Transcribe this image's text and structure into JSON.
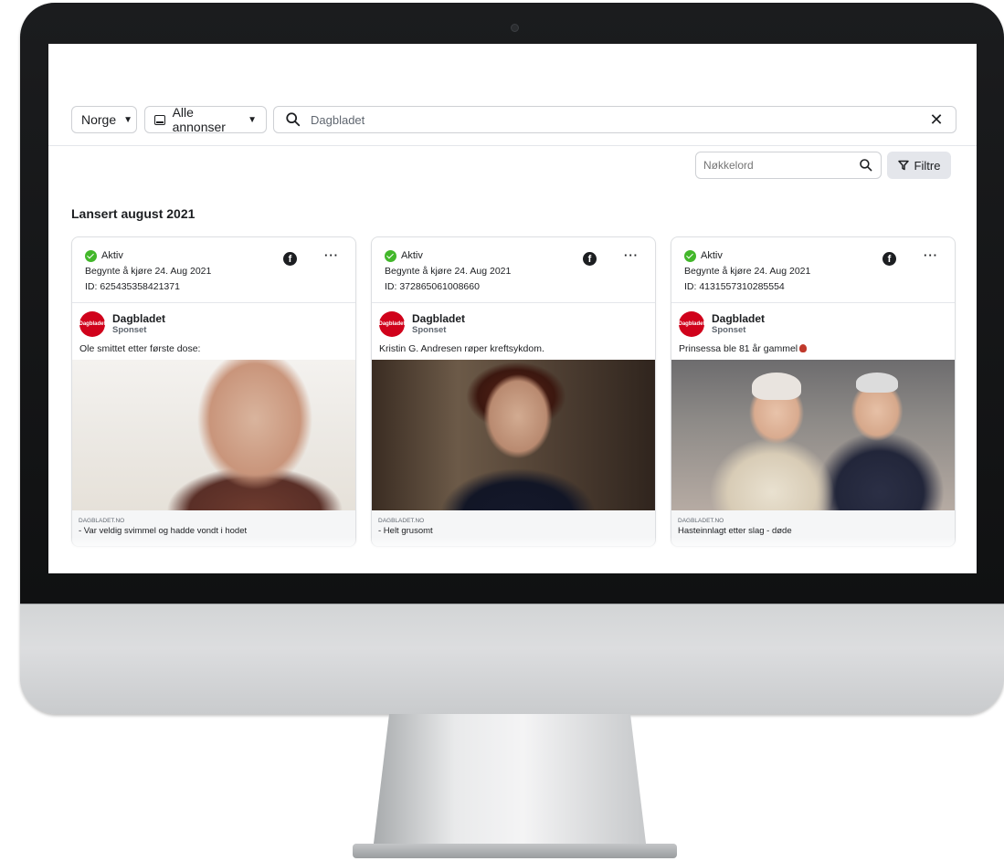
{
  "toolbar": {
    "country": "Norge",
    "ad_type": "Alle annonser",
    "search_value": "Dagbladet"
  },
  "filters": {
    "keyword_placeholder": "Nøkkelord",
    "filter_label": "Filtre"
  },
  "section": {
    "title": "Lansert august 2021"
  },
  "colors": {
    "active_green": "#42b72a",
    "brand_red": "#d0021b",
    "filter_bg": "#e4e6eb"
  },
  "cards": [
    {
      "status": "Aktiv",
      "started": "Begynte å kjøre 24. Aug 2021",
      "id": "ID: 625435358421371",
      "advertiser": "Dagbladet",
      "sponsored": "Sponset",
      "logo_text": "Dagbladet",
      "ad_text": "Ole smittet etter første dose:",
      "domain": "DAGBLADET.NO",
      "headline": "- Var veldig svimmel og hadde vondt i hodet"
    },
    {
      "status": "Aktiv",
      "started": "Begynte å kjøre 24. Aug 2021",
      "id": "ID: 372865061008660",
      "advertiser": "Dagbladet",
      "sponsored": "Sponset",
      "logo_text": "Dagbladet",
      "ad_text": "Kristin G. Andresen røper kreftsykdom.",
      "domain": "DAGBLADET.NO",
      "headline": "- Helt grusomt"
    },
    {
      "status": "Aktiv",
      "started": "Begynte å kjøre 24. Aug 2021",
      "id": "ID: 4131557310285554",
      "advertiser": "Dagbladet",
      "sponsored": "Sponset",
      "logo_text": "Dagbladet",
      "ad_text": "Prinsessa ble 81 år gammel",
      "domain": "DAGBLADET.NO",
      "headline": "Hasteinnlagt etter slag - døde"
    }
  ]
}
